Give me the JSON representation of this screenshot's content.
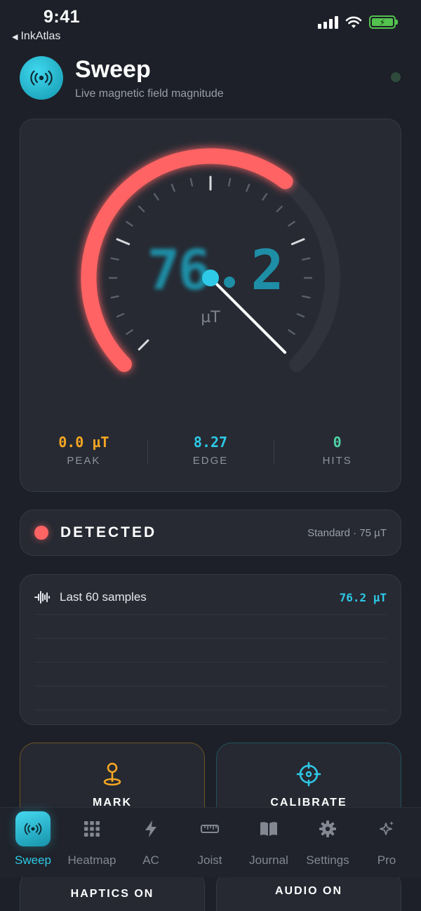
{
  "status_bar": {
    "time": "9:41",
    "back_app": "InkAtlas"
  },
  "header": {
    "title": "Sweep",
    "subtitle": "Live magnetic field magnitude"
  },
  "gauge": {
    "reading_digits_left": "7",
    "reading_digits_mid": "6",
    "reading_digits_right": "2",
    "unit": "µT",
    "arc_fraction": 0.64,
    "needle_fraction": 1.0
  },
  "stats": [
    {
      "value": "0.0 µT",
      "label": "PEAK",
      "color": "#f5a623"
    },
    {
      "value": "8.27",
      "label": "EDGE",
      "color": "#2ec9e6"
    },
    {
      "value": "0",
      "label": "HITS",
      "color": "#4fd1a5"
    }
  ],
  "detection": {
    "status": "DETECTED",
    "mode": "Standard · 75 µT"
  },
  "samples": {
    "title": "Last 60 samples",
    "value": "76.2 µT"
  },
  "actions": {
    "mark": "MARK",
    "calibrate": "CALIBRATE"
  },
  "toggles": {
    "haptics": "HAPTICS ON",
    "audio": "AUDIO ON"
  },
  "tabs": [
    {
      "label": "Sweep",
      "icon": "signal-waves-icon"
    },
    {
      "label": "Heatmap",
      "icon": "grid-icon"
    },
    {
      "label": "AC",
      "icon": "lightning-icon"
    },
    {
      "label": "Joist",
      "icon": "ruler-icon"
    },
    {
      "label": "Journal",
      "icon": "book-icon"
    },
    {
      "label": "Settings",
      "icon": "gear-icon"
    },
    {
      "label": "Pro",
      "icon": "sparkle-icon"
    }
  ],
  "colors": {
    "accent": "#2ec9e6",
    "alert": "#ff6464",
    "warning": "#f5a623"
  }
}
